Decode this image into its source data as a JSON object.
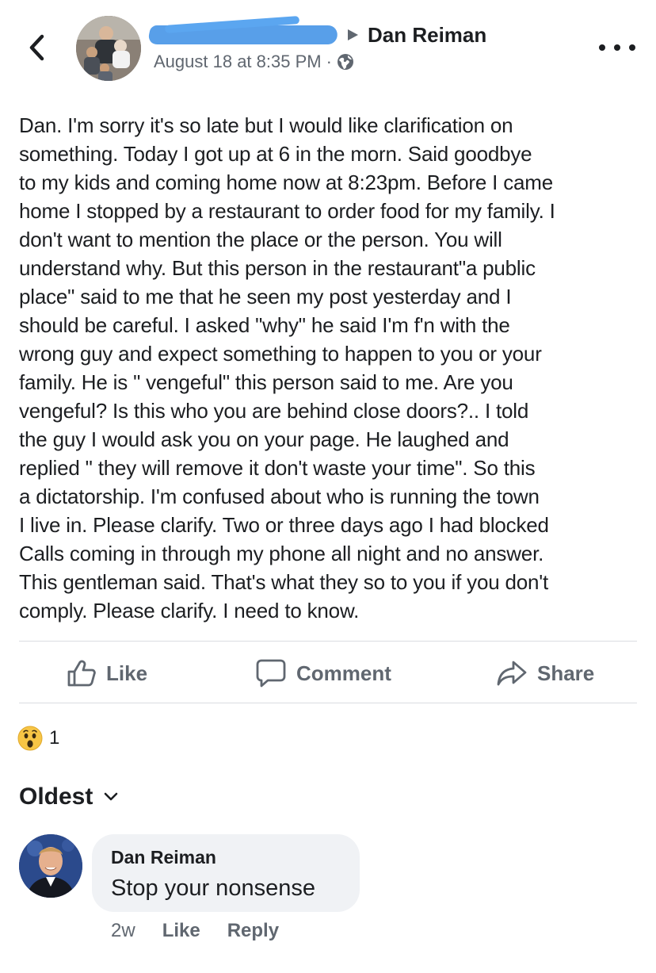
{
  "header": {
    "target_name": "Dan Reiman",
    "timestamp": "August 18 at 8:35 PM",
    "separator": "·"
  },
  "post": {
    "text": "Dan.  I'm sorry it's so late but I would like clarification on\nsomething.  Today I got up at 6 in the morn.  Said goodbye\nto my kids and coming home now at 8:23pm.  Before I came\nhome I stopped by a restaurant to order food for my family. I\ndon't want to mention the place or the person.  You will\nunderstand why.  But this person in the restaurant\"a public\nplace\"  said to me that he seen my post yesterday and I\nshould be careful.  I asked \"why\" he said I'm f'n with the\nwrong guy and expect something to happen to you or your\nfamily.  He is \" vengeful\" this person said to me.  Are you\nvengeful?  Is this who you are behind close doors?.. I told\nthe guy I would ask you on your page.  He laughed and\nreplied \" they will remove it don't waste your time\".  So  this\na dictatorship.   I'm confused about who is running the town\nI live in.  Please clarify.  Two or three days ago I had blocked\nCalls coming in through my phone all night and no answer.\nThis gentleman said.  That's what they so to you if you don't\ncomply.  Please clarify.  I need to know."
  },
  "actions": {
    "like": "Like",
    "comment": "Comment",
    "share": "Share"
  },
  "reactions": {
    "type": "wow",
    "count": "1"
  },
  "comments_sort": {
    "label": "Oldest"
  },
  "comments": [
    {
      "author": "Dan Reiman",
      "text": "Stop your nonsense",
      "age": "2w",
      "like_label": "Like",
      "reply_label": "Reply"
    }
  ],
  "colors": {
    "text": "#1c1e21",
    "secondary": "#606770",
    "bubble": "#f0f2f5",
    "redaction": "#4f9ae8"
  }
}
